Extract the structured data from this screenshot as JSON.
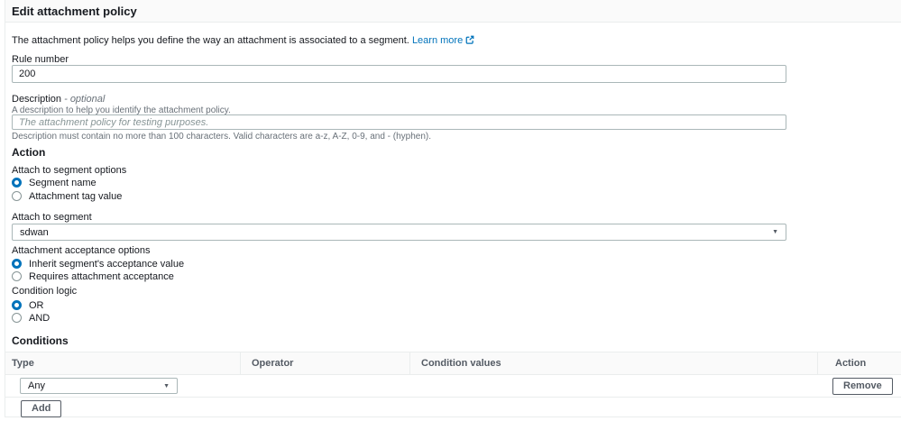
{
  "colors": {
    "accent_link": "#0073bb",
    "radio_selected": "#0073bb",
    "header_bg": "#fafafa",
    "divider": "#eaeded",
    "text": "#16191f",
    "secondary_text": "#687078",
    "input_border": "#aab7b8",
    "button_border": "#545b64"
  },
  "icons": {
    "external_link": "external-link-icon",
    "caret_glyph": "▼"
  },
  "header": {
    "title": "Edit attachment policy"
  },
  "intro": {
    "text": "The attachment policy helps you define the way an attachment is associated to a segment.",
    "link_label": "Learn more"
  },
  "rule_number": {
    "label": "Rule number",
    "value": "200"
  },
  "description": {
    "label": "Description",
    "optional_suffix": "- optional",
    "help": "A description to help you identify the attachment policy.",
    "placeholder": "The attachment policy for testing purposes.",
    "constraint": "Description must contain no more than 100 characters. Valid characters are a-z, A-Z, 0-9, and - (hyphen)."
  },
  "action_section": {
    "title": "Action",
    "segment_options": {
      "label": "Attach to segment options",
      "options": [
        {
          "label": "Segment name",
          "selected": true
        },
        {
          "label": "Attachment tag value",
          "selected": false
        }
      ]
    },
    "attach_to_segment": {
      "label": "Attach to segment",
      "value": "sdwan"
    },
    "acceptance_options": {
      "label": "Attachment acceptance options",
      "options": [
        {
          "label": "Inherit segment's acceptance value",
          "selected": true
        },
        {
          "label": "Requires attachment acceptance",
          "selected": false
        }
      ]
    },
    "condition_logic": {
      "label": "Condition logic",
      "options": [
        {
          "label": "OR",
          "selected": true
        },
        {
          "label": "AND",
          "selected": false
        }
      ]
    }
  },
  "conditions": {
    "title": "Conditions",
    "columns": [
      "Type",
      "Operator",
      "Condition values",
      "Action"
    ],
    "rows": [
      {
        "type_value": "Any",
        "operator": "",
        "condition_values": "",
        "action_label": "Remove"
      }
    ],
    "add_label": "Add"
  }
}
